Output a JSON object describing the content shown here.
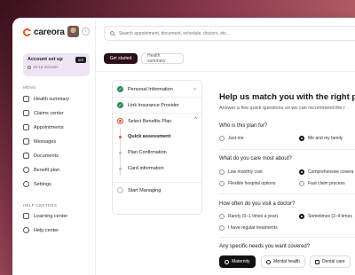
{
  "brand": {
    "name": "careora"
  },
  "setup": {
    "title": "Account set up",
    "time": "10-15 minutes",
    "badge": "1/4"
  },
  "menu": {
    "label": "MENU",
    "items": [
      {
        "label": "Health summary"
      },
      {
        "label": "Claims center"
      },
      {
        "label": "Appointments"
      },
      {
        "label": "Messages"
      },
      {
        "label": "Documents"
      },
      {
        "label": "Benefit plan"
      },
      {
        "label": "Settings"
      }
    ]
  },
  "help": {
    "label": "HELP CENTERS",
    "items": [
      {
        "label": "Learning center"
      },
      {
        "label": "Help center"
      }
    ]
  },
  "search": {
    "placeholder": "Search appointment, document, schedule, doctors, etc..."
  },
  "tabs": [
    {
      "label": "Get started"
    },
    {
      "label": "Health summary"
    }
  ],
  "steps": [
    {
      "label": "Personal Information"
    },
    {
      "label": "Link Insurance Provider"
    },
    {
      "label": "Select Benefits Plan"
    },
    {
      "label": "Quick assessment"
    },
    {
      "label": "Plan Confirmation"
    },
    {
      "label": "Card information"
    },
    {
      "label": "Start Managing"
    }
  ],
  "form": {
    "title": "Help us match you with the right plan",
    "subtitle": "Answer a few quick questions so we can recommend the r",
    "q1": {
      "text": "Who is this plan for?",
      "options": [
        "Just me",
        "Me and my family"
      ],
      "selected": "Me and my family"
    },
    "q2": {
      "text": "What do you care most about?",
      "options": [
        "Low monthly cost",
        "Comprehensive covera",
        "Flexible hospital options",
        "Fast claim process"
      ],
      "selected": "Comprehensive covera"
    },
    "q3": {
      "text": "How often do you visit a doctor?",
      "options": [
        "Rarely (0–1 times a year)",
        "Sometimes (2–4 times",
        "I have regular treatments"
      ],
      "selected": "Sometimes (2–4 times"
    },
    "q4": {
      "text": "Any specific needs you want covered?",
      "chips": [
        "Maternity",
        "Mental health",
        "Dental care"
      ],
      "selected": "Maternity"
    }
  },
  "colors": {
    "accent": "#e2552d",
    "done": "#2e8b57",
    "dark": "#111111",
    "setup_bg": "#efe4f6"
  }
}
